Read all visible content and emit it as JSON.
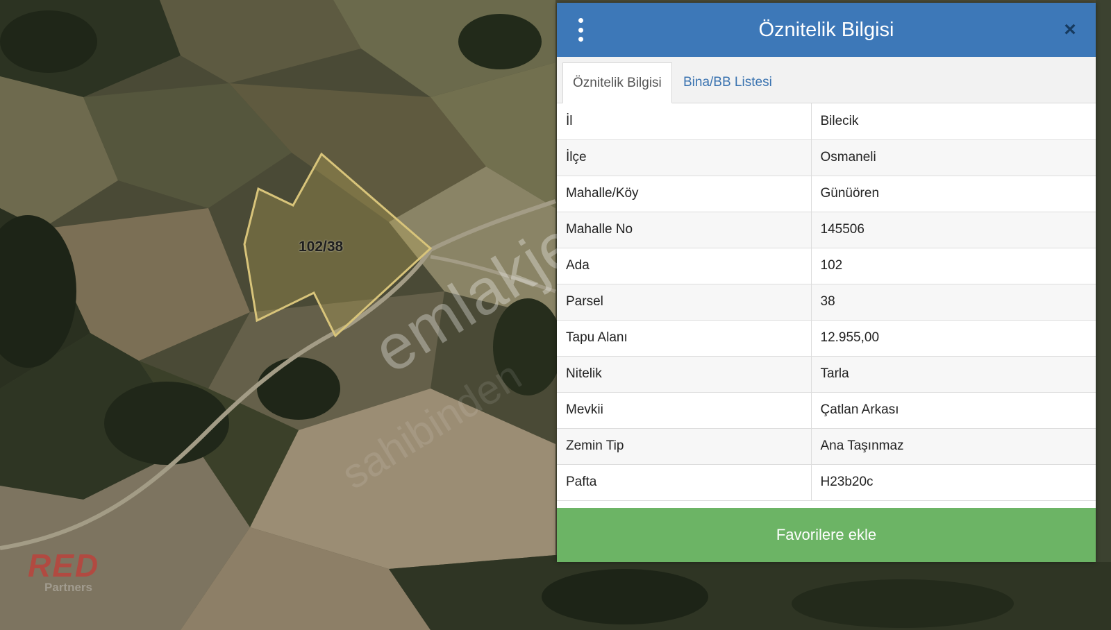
{
  "map": {
    "parcel_label": "102/38",
    "watermark": "emlakjet.com",
    "watermark_secondary": "sahibinden",
    "logo_main": "RED",
    "logo_sub": "Partners"
  },
  "panel": {
    "title": "Öznitelik Bilgisi",
    "menu_icon": "vertical-dots-icon",
    "close_icon": "close-icon",
    "tabs": [
      {
        "label": "Öznitelik Bilgisi",
        "active": true
      },
      {
        "label": "Bina/BB Listesi",
        "active": false
      }
    ],
    "rows": [
      {
        "key": "İl",
        "value": "Bilecik"
      },
      {
        "key": "İlçe",
        "value": "Osmaneli"
      },
      {
        "key": "Mahalle/Köy",
        "value": "Günüören"
      },
      {
        "key": "Mahalle No",
        "value": "145506"
      },
      {
        "key": "Ada",
        "value": "102"
      },
      {
        "key": "Parsel",
        "value": "38"
      },
      {
        "key": "Tapu Alanı",
        "value": "12.955,00"
      },
      {
        "key": "Nitelik",
        "value": "Tarla"
      },
      {
        "key": "Mevkii",
        "value": "Çatlan Arkası"
      },
      {
        "key": "Zemin Tip",
        "value": "Ana Taşınmaz"
      },
      {
        "key": "Pafta",
        "value": "H23b20c"
      }
    ],
    "favorite_button": "Favorilere ekle"
  },
  "colors": {
    "header": "#3d78b8",
    "tab_link": "#3a73b0",
    "favorite_button": "#6cb465",
    "parcel_outline": "#d8c47a"
  }
}
